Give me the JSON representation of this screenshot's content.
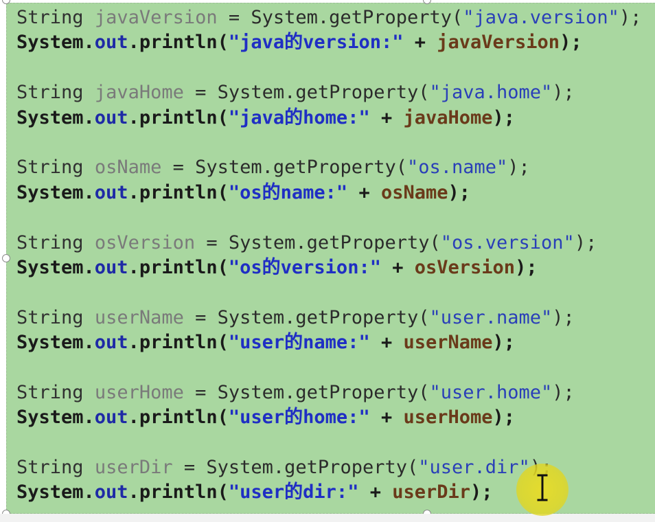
{
  "code_lines": [
    {
      "type": "decl",
      "kw": "String",
      "var": "javaVersion",
      "rest_pre": " = System.getProperty(",
      "str": "\"java.version\"",
      "rest_post": ");"
    },
    {
      "type": "print",
      "sys": "System.",
      "out": "out",
      "meth": ".println(",
      "str": "\"java的version:\"",
      "plus": " + ",
      "ref": "javaVersion",
      "end": ");"
    },
    {
      "type": "blank"
    },
    {
      "type": "decl",
      "kw": "String",
      "var": "javaHome",
      "rest_pre": " = System.getProperty(",
      "str": "\"java.home\"",
      "rest_post": ");"
    },
    {
      "type": "print",
      "sys": "System.",
      "out": "out",
      "meth": ".println(",
      "str": "\"java的home:\"",
      "plus": " + ",
      "ref": "javaHome",
      "end": ");"
    },
    {
      "type": "blank"
    },
    {
      "type": "decl",
      "kw": "String",
      "var": "osName",
      "rest_pre": " = System.getProperty(",
      "str": "\"os.name\"",
      "rest_post": ");"
    },
    {
      "type": "print",
      "sys": "System.",
      "out": "out",
      "meth": ".println(",
      "str": "\"os的name:\"",
      "plus": " + ",
      "ref": "osName",
      "end": ");"
    },
    {
      "type": "blank"
    },
    {
      "type": "decl",
      "kw": "String",
      "var": "osVersion",
      "rest_pre": " = System.getProperty(",
      "str": "\"os.version\"",
      "rest_post": ");"
    },
    {
      "type": "print",
      "sys": "System.",
      "out": "out",
      "meth": ".println(",
      "str": "\"os的version:\"",
      "plus": " + ",
      "ref": "osVersion",
      "end": ");"
    },
    {
      "type": "blank"
    },
    {
      "type": "decl",
      "kw": "String",
      "var": "userName",
      "rest_pre": " = System.getProperty(",
      "str": "\"user.name\"",
      "rest_post": ");"
    },
    {
      "type": "print",
      "sys": "System.",
      "out": "out",
      "meth": ".println(",
      "str": "\"user的name:\"",
      "plus": " + ",
      "ref": "userName",
      "end": ");"
    },
    {
      "type": "blank"
    },
    {
      "type": "decl",
      "kw": "String",
      "var": "userHome",
      "rest_pre": " = System.getProperty(",
      "str": "\"user.home\"",
      "rest_post": ");"
    },
    {
      "type": "print",
      "sys": "System.",
      "out": "out",
      "meth": ".println(",
      "str": "\"user的home:\"",
      "plus": " + ",
      "ref": "userHome",
      "end": ");"
    },
    {
      "type": "blank"
    },
    {
      "type": "decl",
      "kw": "String",
      "var": "userDir",
      "rest_pre": " = System.getProperty(",
      "str": "\"user.dir\"",
      "rest_post": ");"
    },
    {
      "type": "print",
      "sys": "System.",
      "out": "out",
      "meth": ".println(",
      "str": "\"user的dir:\"",
      "plus": " + ",
      "ref": "userDir",
      "end": ");"
    }
  ],
  "icons": {
    "cursor": "i-beam-cursor-icon",
    "highlight": "cursor-highlight"
  },
  "colors": {
    "slide_background": "#a9d7a0",
    "string_literal": "#2a3fb8",
    "out_field": "#1e2aa6",
    "variable_reference": "#6a3a1a",
    "cursor_highlight": "#e6da28"
  }
}
